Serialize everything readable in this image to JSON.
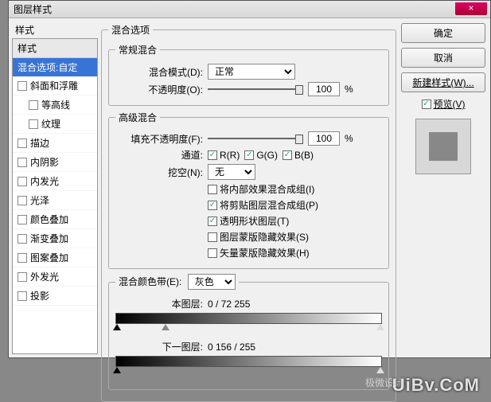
{
  "window": {
    "title": "图层样式",
    "close": "×"
  },
  "left": {
    "header": "样式",
    "selected": "混合选项:自定",
    "items": [
      {
        "label": "斜面和浮雕",
        "checked": false,
        "sub": false
      },
      {
        "label": "等高线",
        "checked": false,
        "sub": true
      },
      {
        "label": "纹理",
        "checked": false,
        "sub": true
      },
      {
        "label": "描边",
        "checked": false,
        "sub": false
      },
      {
        "label": "内阴影",
        "checked": false,
        "sub": false
      },
      {
        "label": "内发光",
        "checked": false,
        "sub": false
      },
      {
        "label": "光泽",
        "checked": false,
        "sub": false
      },
      {
        "label": "颜色叠加",
        "checked": false,
        "sub": false
      },
      {
        "label": "渐变叠加",
        "checked": false,
        "sub": false
      },
      {
        "label": "图案叠加",
        "checked": false,
        "sub": false
      },
      {
        "label": "外发光",
        "checked": false,
        "sub": false
      },
      {
        "label": "投影",
        "checked": false,
        "sub": false
      }
    ]
  },
  "blend": {
    "group": "混合选项",
    "normal_group": "常规混合",
    "mode_label": "混合模式(D):",
    "mode_value": "正常",
    "opacity_label": "不透明度(O):",
    "opacity_value": "100",
    "pct": "%",
    "adv_group": "高级混合",
    "fill_label": "填充不透明度(F):",
    "fill_value": "100",
    "channel_label": "通道:",
    "ch_r": "R(R)",
    "ch_g": "G(G)",
    "ch_b": "B(B)",
    "knockout_label": "挖空(N):",
    "knockout_value": "无",
    "opts": [
      {
        "label": "将内部效果混合成组(I)",
        "checked": false
      },
      {
        "label": "将剪贴图层混合成组(P)",
        "checked": true
      },
      {
        "label": "透明形状图层(T)",
        "checked": true
      },
      {
        "label": "图层蒙版隐藏效果(S)",
        "checked": false
      },
      {
        "label": "矢量蒙版隐藏效果(H)",
        "checked": false
      }
    ],
    "band_group_label": "混合颜色带(E):",
    "band_value": "灰色",
    "this_layer": "本图层:",
    "this_vals": "0  /  72       255",
    "under_layer": "下一图层:",
    "under_vals": "0            156  /  255"
  },
  "right": {
    "ok": "确定",
    "cancel": "取消",
    "new_style": "新建样式(W)...",
    "preview_label": "预览(V)"
  },
  "watermark": "UiBv.CoM",
  "watermark2": "极微设计"
}
